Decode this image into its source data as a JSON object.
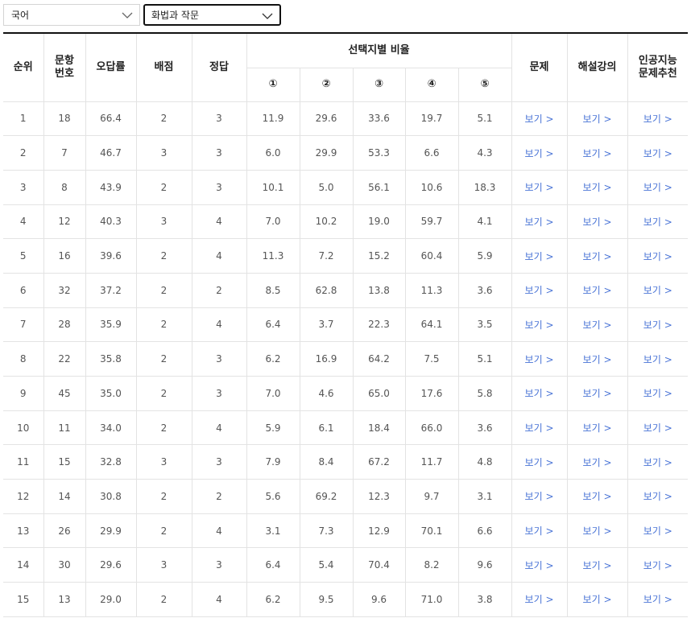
{
  "filters": {
    "subject": "국어",
    "option": "화법과 작문"
  },
  "table": {
    "headers": {
      "rank": "순위",
      "question_no": [
        "문항",
        "번호"
      ],
      "error_rate": "오답률",
      "points": "배점",
      "answer": "정답",
      "choice_ratio": "선택지별 비율",
      "choices": [
        "①",
        "②",
        "③",
        "④",
        "⑤"
      ],
      "problem": "문제",
      "lecture": "해설강의",
      "ai": [
        "인공지능",
        "문제추천"
      ]
    },
    "view_label": "보기 >",
    "rows": [
      {
        "rank": "1",
        "no": "18",
        "err": "66.4",
        "pts": "2",
        "ans": "3",
        "c": [
          "11.9",
          "29.6",
          "33.6",
          "19.7",
          "5.1"
        ]
      },
      {
        "rank": "2",
        "no": "7",
        "err": "46.7",
        "pts": "3",
        "ans": "3",
        "c": [
          "6.0",
          "29.9",
          "53.3",
          "6.6",
          "4.3"
        ]
      },
      {
        "rank": "3",
        "no": "8",
        "err": "43.9",
        "pts": "2",
        "ans": "3",
        "c": [
          "10.1",
          "5.0",
          "56.1",
          "10.6",
          "18.3"
        ]
      },
      {
        "rank": "4",
        "no": "12",
        "err": "40.3",
        "pts": "3",
        "ans": "4",
        "c": [
          "7.0",
          "10.2",
          "19.0",
          "59.7",
          "4.1"
        ]
      },
      {
        "rank": "5",
        "no": "16",
        "err": "39.6",
        "pts": "2",
        "ans": "4",
        "c": [
          "11.3",
          "7.2",
          "15.2",
          "60.4",
          "5.9"
        ]
      },
      {
        "rank": "6",
        "no": "32",
        "err": "37.2",
        "pts": "2",
        "ans": "2",
        "c": [
          "8.5",
          "62.8",
          "13.8",
          "11.3",
          "3.6"
        ]
      },
      {
        "rank": "7",
        "no": "28",
        "err": "35.9",
        "pts": "2",
        "ans": "4",
        "c": [
          "6.4",
          "3.7",
          "22.3",
          "64.1",
          "3.5"
        ]
      },
      {
        "rank": "8",
        "no": "22",
        "err": "35.8",
        "pts": "2",
        "ans": "3",
        "c": [
          "6.2",
          "16.9",
          "64.2",
          "7.5",
          "5.1"
        ]
      },
      {
        "rank": "9",
        "no": "45",
        "err": "35.0",
        "pts": "2",
        "ans": "3",
        "c": [
          "7.0",
          "4.6",
          "65.0",
          "17.6",
          "5.8"
        ]
      },
      {
        "rank": "10",
        "no": "11",
        "err": "34.0",
        "pts": "2",
        "ans": "4",
        "c": [
          "5.9",
          "6.1",
          "18.4",
          "66.0",
          "3.6"
        ]
      },
      {
        "rank": "11",
        "no": "15",
        "err": "32.8",
        "pts": "3",
        "ans": "3",
        "c": [
          "7.9",
          "8.4",
          "67.2",
          "11.7",
          "4.8"
        ]
      },
      {
        "rank": "12",
        "no": "14",
        "err": "30.8",
        "pts": "2",
        "ans": "2",
        "c": [
          "5.6",
          "69.2",
          "12.3",
          "9.7",
          "3.1"
        ]
      },
      {
        "rank": "13",
        "no": "26",
        "err": "29.9",
        "pts": "2",
        "ans": "4",
        "c": [
          "3.1",
          "7.3",
          "12.9",
          "70.1",
          "6.6"
        ]
      },
      {
        "rank": "14",
        "no": "30",
        "err": "29.6",
        "pts": "3",
        "ans": "3",
        "c": [
          "6.4",
          "5.4",
          "70.4",
          "8.2",
          "9.6"
        ]
      },
      {
        "rank": "15",
        "no": "13",
        "err": "29.0",
        "pts": "2",
        "ans": "4",
        "c": [
          "6.2",
          "9.5",
          "9.6",
          "71.0",
          "3.8"
        ]
      }
    ]
  }
}
